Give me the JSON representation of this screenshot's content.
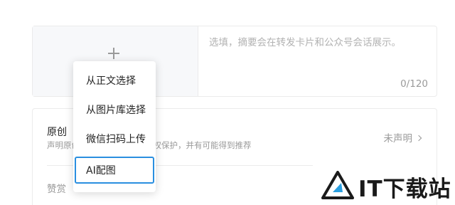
{
  "cover": {
    "add_icon": "plus-icon"
  },
  "summary": {
    "placeholder": "选填，摘要会在转发卡片和公众号会话展示。",
    "char_count": "0/120"
  },
  "original": {
    "title": "原创",
    "desc_left": "声明原创",
    "desc_right": "作权保护，并有可能得到推荐",
    "status": "未声明"
  },
  "reward": {
    "title": "赞赏"
  },
  "cover_menu": {
    "items": [
      {
        "label": "从正文选择"
      },
      {
        "label": "从图片库选择"
      },
      {
        "label": "微信扫码上传"
      },
      {
        "label": "AI配图"
      }
    ],
    "active_border_color": "#2a8fe0"
  },
  "watermark": {
    "text": "IT下载站"
  }
}
